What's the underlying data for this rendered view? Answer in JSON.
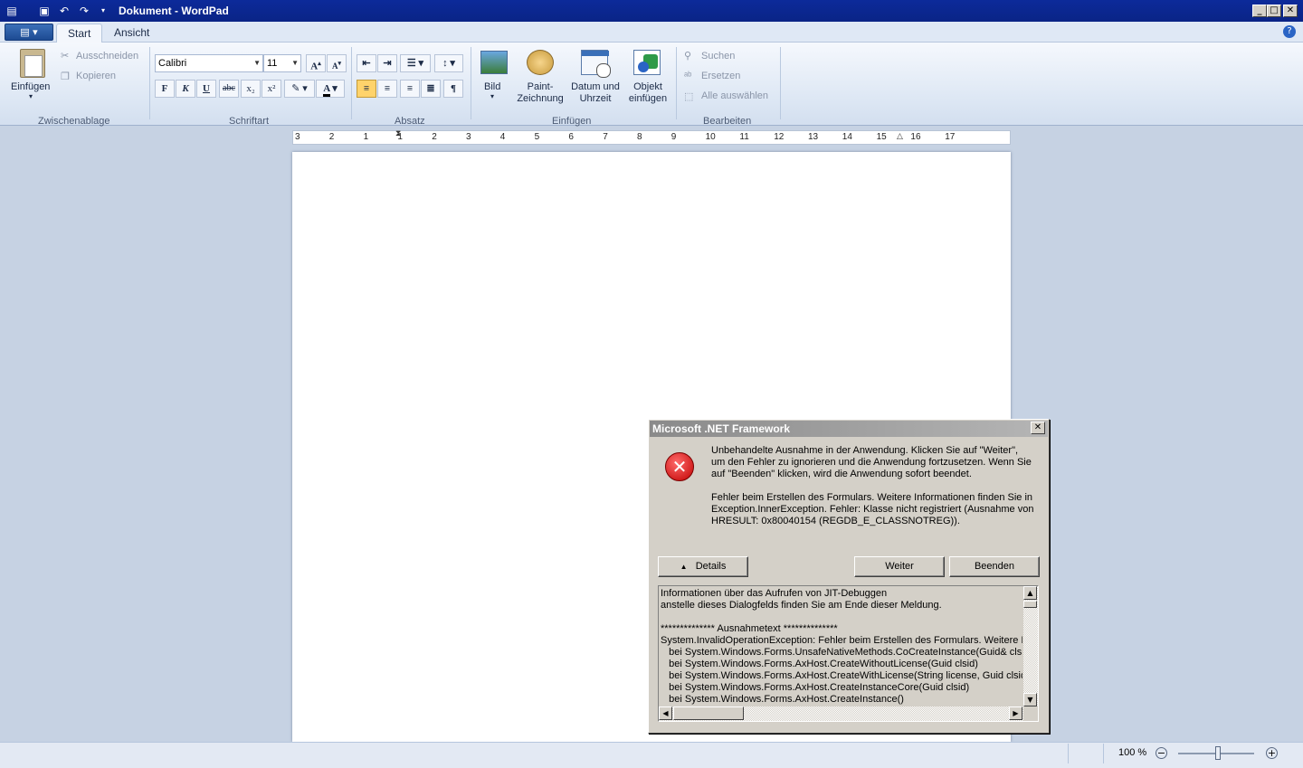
{
  "window": {
    "title": "Dokument - WordPad"
  },
  "tabs": [
    "Start",
    "Ansicht"
  ],
  "ribbon": {
    "clipboard": {
      "paste": "Einfügen",
      "cut": "Ausschneiden",
      "copy": "Kopieren",
      "group": "Zwischenablage"
    },
    "font": {
      "name": "Calibri",
      "size": "11",
      "group": "Schriftart",
      "bold": "F",
      "italic": "K",
      "underline": "U",
      "strike": "abc",
      "sub": "x₂",
      "sup": "x²"
    },
    "paragraph": {
      "group": "Absatz"
    },
    "insert": {
      "picture": "Bild",
      "paint": "Paint-\nZeichnung",
      "datetime": "Datum und\nUhrzeit",
      "object": "Objekt\neinfügen",
      "group": "Einfügen"
    },
    "edit": {
      "find": "Suchen",
      "replace": "Ersetzen",
      "selectall": "Alle auswählen",
      "group": "Bearbeiten"
    }
  },
  "ruler": {
    "ticks": [
      "3",
      "2",
      "1",
      "1",
      "2",
      "3",
      "4",
      "5",
      "6",
      "7",
      "8",
      "9",
      "10",
      "11",
      "12",
      "13",
      "14",
      "15",
      "16",
      "17"
    ]
  },
  "status": {
    "zoom": "100 %"
  },
  "dialog": {
    "title": "Microsoft .NET Framework",
    "message1": "Unbehandelte Ausnahme in der Anwendung. Klicken Sie auf \"Weiter\",\num den Fehler zu ignorieren und die Anwendung fortzusetzen. Wenn Sie\nauf \"Beenden\" klicken, wird die Anwendung sofort beendet.",
    "message2": "Fehler beim Erstellen des Formulars. Weitere Informationen finden Sie in\nException.InnerException. Fehler: Klasse nicht registriert (Ausnahme von\nHRESULT: 0x80040154 (REGDB_E_CLASSNOTREG)).",
    "details_button": "Details",
    "continue_button": "Weiter",
    "quit_button": "Beenden",
    "details_text": "Informationen über das Aufrufen von JIT-Debuggen\nanstelle dieses Dialogfelds finden Sie am Ende dieser Meldung.\n\n************** Ausnahmetext **************\nSystem.InvalidOperationException: Fehler beim Erstellen des Formulars. Weitere Infor\n   bei System.Windows.Forms.UnsafeNativeMethods.CoCreateInstance(Guid& clsid, O\n   bei System.Windows.Forms.AxHost.CreateWithoutLicense(Guid clsid)\n   bei System.Windows.Forms.AxHost.CreateWithLicense(String license, Guid clsid)\n   bei System.Windows.Forms.AxHost.CreateInstanceCore(Guid clsid)\n   bei System.Windows.Forms.AxHost.CreateInstance()"
  }
}
